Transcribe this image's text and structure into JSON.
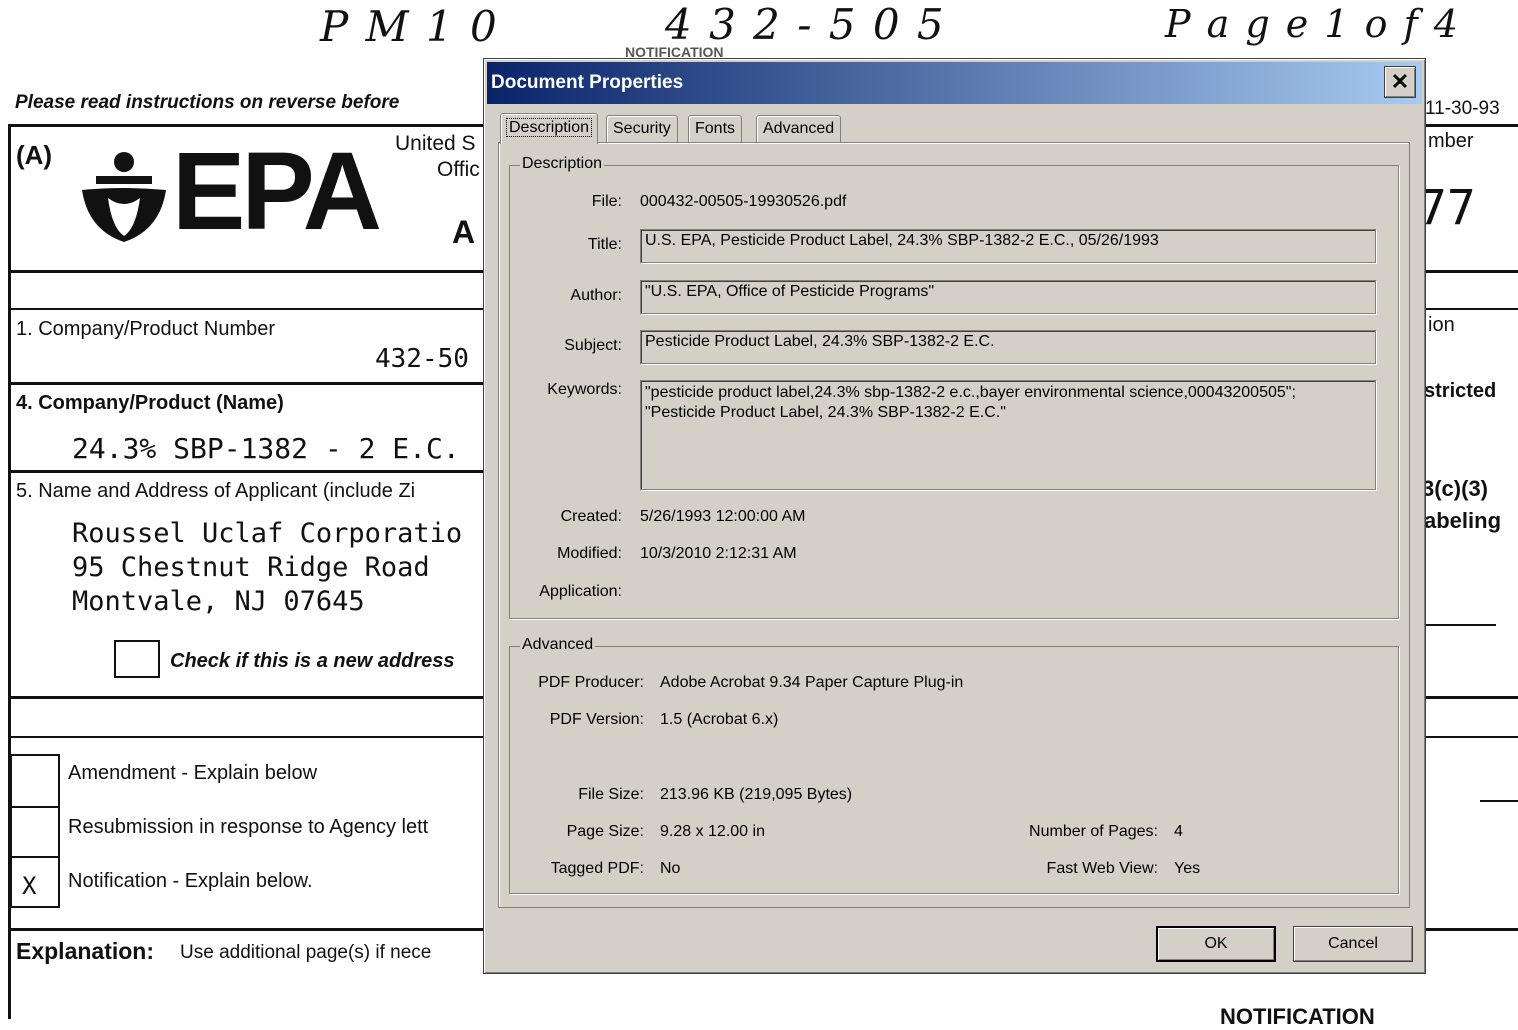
{
  "background_doc": {
    "handwritten": {
      "left": "P M 1 0",
      "middle": "4 3 2 - 5 0 5",
      "right": "P a g e   1   o f   4"
    },
    "header_faint": "NOTIFICATION",
    "instructions": "Please read instructions on reverse before",
    "section_a": "(A)",
    "epa_logo": "EPA",
    "agency_line1": "United S",
    "agency_line2": "Offic",
    "agency_line3": "A",
    "date_right": "11-30-93",
    "number_label": "mber",
    "number_value": "77",
    "field1_label": "1.  Company/Product Number",
    "field1_value": "432-50",
    "field4_label": "4.  Company/Product (Name)",
    "field4_value": "24.3% SBP-1382 - 2 E.C.",
    "field5_label": "5.  Name and Address of Applicant (include Zi",
    "address_line1": "Roussel Uclaf Corporatio",
    "address_line2": "95 Chestnut Ridge Road",
    "address_line3": "Montvale, NJ 07645",
    "new_address": "Check if this is a new address",
    "right_ion": "ion",
    "right_stricted": "stricted",
    "right_c3": "3(c)(3)",
    "right_labeling": "abeling",
    "amendment": "Amendment - Explain below",
    "resubmission": "Resubmission in response to Agency lett",
    "notification": "Notification - Explain below.",
    "notification_mark": "X",
    "explanation_label": "Explanation:",
    "explanation_text": "Use additional page(s) if nece",
    "bottom_right": "NOTIFICATION"
  },
  "dialog": {
    "title": "Document Properties",
    "close_glyph": "✕",
    "tabs": [
      "Description",
      "Security",
      "Fonts",
      "Advanced"
    ],
    "description_group": {
      "legend": "Description",
      "file_label": "File:",
      "file": "000432-00505-19930526.pdf",
      "title_label": "Title:",
      "title": "U.S. EPA, Pesticide Product Label, 24.3% SBP-1382-2 E.C., 05/26/1993",
      "author_label": "Author:",
      "author": "\"U.S. EPA, Office of Pesticide Programs\"",
      "subject_label": "Subject:",
      "subject": "Pesticide Product Label, 24.3% SBP-1382-2 E.C.",
      "keywords_label": "Keywords:",
      "keywords_line1": "\"pesticide product label,24.3% sbp-1382-2 e.c.,bayer environmental science,00043200505\";",
      "keywords_line2": "\"Pesticide Product Label, 24.3% SBP-1382-2 E.C.\"",
      "created_label": "Created:",
      "created": "5/26/1993 12:00:00 AM",
      "modified_label": "Modified:",
      "modified": "10/3/2010 2:12:31 AM",
      "application_label": "Application:",
      "application": ""
    },
    "advanced_group": {
      "legend": "Advanced",
      "producer_label": "PDF Producer:",
      "producer": "Adobe Acrobat 9.34 Paper Capture Plug-in",
      "version_label": "PDF Version:",
      "version": "1.5 (Acrobat 6.x)",
      "filesize_label": "File Size:",
      "filesize": "213.96 KB (219,095 Bytes)",
      "pagesize_label": "Page Size:",
      "pagesize": "9.28 x 12.00 in",
      "pages_label": "Number of Pages:",
      "pages": "4",
      "tagged_label": "Tagged PDF:",
      "tagged": "No",
      "fastweb_label": "Fast Web View:",
      "fastweb": "Yes"
    },
    "ok_label": "OK",
    "cancel_label": "Cancel"
  }
}
